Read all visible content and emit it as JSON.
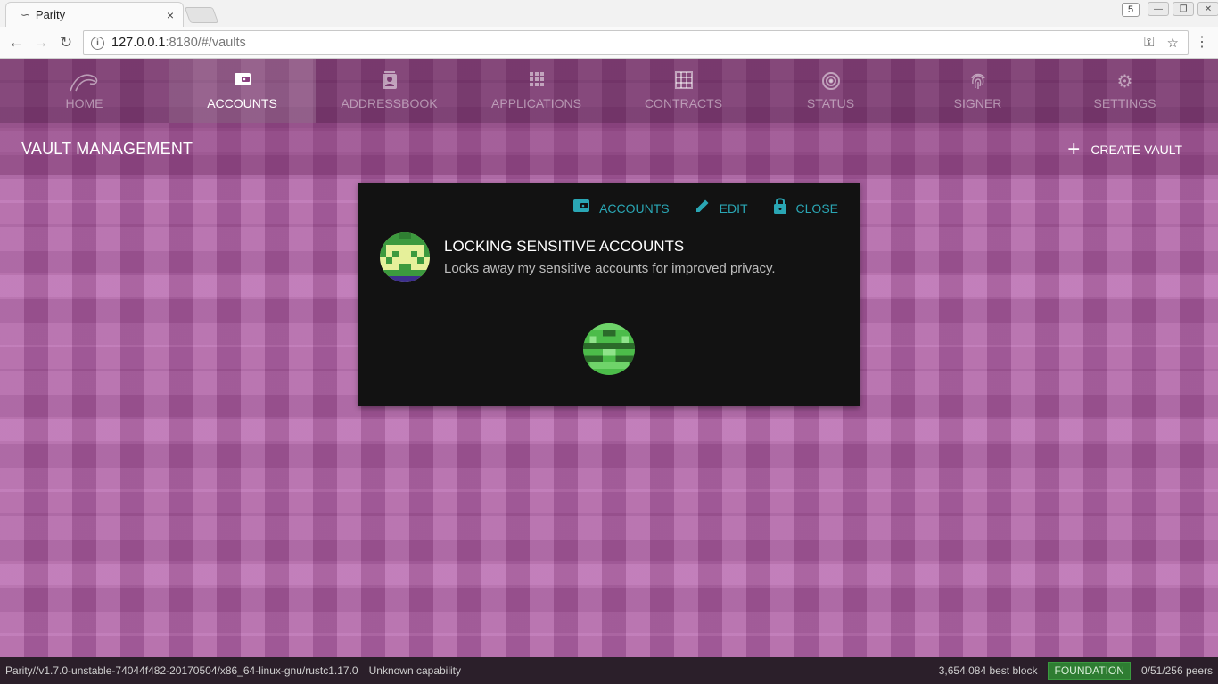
{
  "browser": {
    "tab_title": "Parity",
    "tab_close": "×",
    "ext_badge": "5",
    "url_host": "127.0.0.1",
    "url_rest": ":8180/#/vaults"
  },
  "nav": {
    "items": [
      {
        "label": "HOME",
        "icon": "parity-logo-icon"
      },
      {
        "label": "ACCOUNTS",
        "icon": "wallet-icon",
        "active": true
      },
      {
        "label": "ADDRESSBOOK",
        "icon": "contact-card-icon"
      },
      {
        "label": "APPLICATIONS",
        "icon": "apps-grid-icon"
      },
      {
        "label": "CONTRACTS",
        "icon": "table-grid-icon"
      },
      {
        "label": "STATUS",
        "icon": "radar-icon"
      },
      {
        "label": "SIGNER",
        "icon": "fingerprint-icon"
      },
      {
        "label": "SETTINGS",
        "icon": "gear-icon"
      }
    ]
  },
  "subbar": {
    "title": "VAULT MANAGEMENT",
    "create_label": "CREATE VAULT"
  },
  "vault": {
    "actions": {
      "accounts": "ACCOUNTS",
      "edit": "EDIT",
      "close": "CLOSE"
    },
    "name": "LOCKING SENSITIVE ACCOUNTS",
    "description": "Locks away my sensitive accounts for improved privacy."
  },
  "status": {
    "version": "Parity//v1.7.0-unstable-74044f482-20170504/x86_64-linux-gnu/rustc1.17.0",
    "capability": "Unknown capability",
    "block": "3,654,084 best block",
    "chain": "FOUNDATION",
    "peers": "0/51/256 peers"
  },
  "colors": {
    "accent": "#2aa6b4",
    "background": "#b45fa9",
    "card": "#121212",
    "chain_badge": "#2e7d32"
  }
}
